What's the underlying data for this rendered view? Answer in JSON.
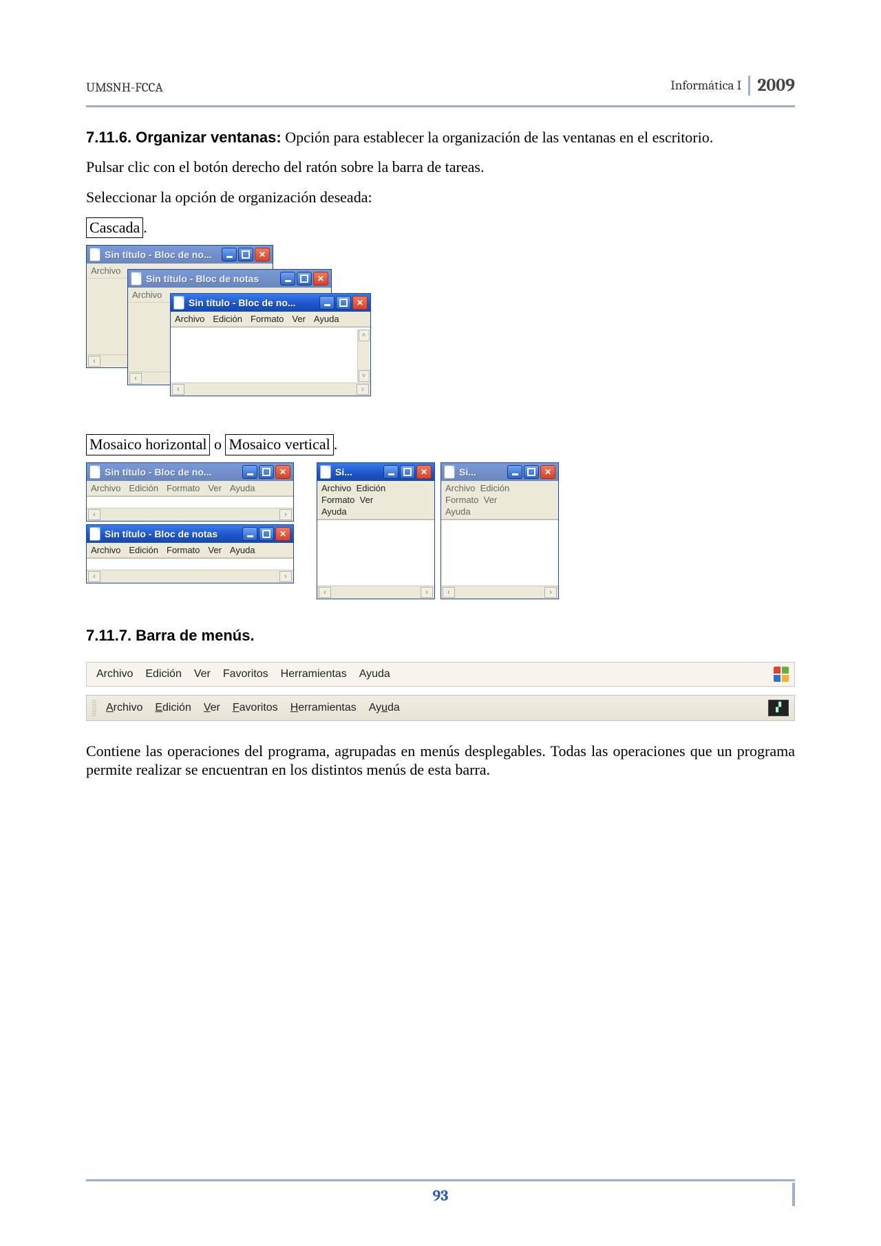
{
  "header": {
    "left": "UMSNH-FCCA",
    "subject": "Informática I",
    "year": "2009"
  },
  "sec1": {
    "heading_num": "7.11.6. Organizar ventanas:",
    "heading_rest": " Opción para establecer la organización de las ventanas en el escritorio.",
    "p1": "Pulsar clic con el botón derecho del ratón sobre la barra de tareas.",
    "p2": "Seleccionar la opción de organización deseada:",
    "opt_cascada": "Cascada",
    "opt_mos_h": "Mosaico horizontal",
    "opt_mos_v": "Mosaico vertical",
    "sep_o": " o "
  },
  "cascade": {
    "w1_title": "Sin título - Bloc de no...",
    "w1_menu": [
      "Archivo"
    ],
    "w2_title": "Sin título - Bloc de notas",
    "w2_menu": [
      "Archivo"
    ],
    "w3_title": "Sin título - Bloc de no...",
    "w3_menu": [
      "Archivo",
      "Edición",
      "Formato",
      "Ver",
      "Ayuda"
    ]
  },
  "mosaic_h": {
    "top_title": "Sin título - Bloc de no...",
    "top_menu": [
      "Archivo",
      "Edición",
      "Formato",
      "Ver",
      "Ayuda"
    ],
    "bot_title": "Sin título - Bloc de notas",
    "bot_menu": [
      "Archivo",
      "Edición",
      "Formato",
      "Ver",
      "Ayuda"
    ]
  },
  "mosaic_v": {
    "left_title": "Si...",
    "left_menu": [
      "Archivo",
      "Edición",
      "Formato",
      "Ver",
      "Ayuda"
    ],
    "right_title": "Si...",
    "right_menu": [
      "Archivo",
      "Edición",
      "Formato",
      "Ver",
      "Ayuda"
    ]
  },
  "sec2": {
    "heading": "7.11.7. Barra de menús.",
    "menubar1": [
      "Archivo",
      "Edición",
      "Ver",
      "Favoritos",
      "Herramientas",
      "Ayuda"
    ],
    "menubar2": [
      "Archivo",
      "Edición",
      "Ver",
      "Favoritos",
      "Herramientas",
      "Ayuda"
    ],
    "p": "Contiene las operaciones del programa, agrupadas en menús desplegables. Todas las operaciones que un programa permite realizar se encuentran en los distintos menús de esta barra."
  },
  "footer": {
    "page": "93"
  }
}
